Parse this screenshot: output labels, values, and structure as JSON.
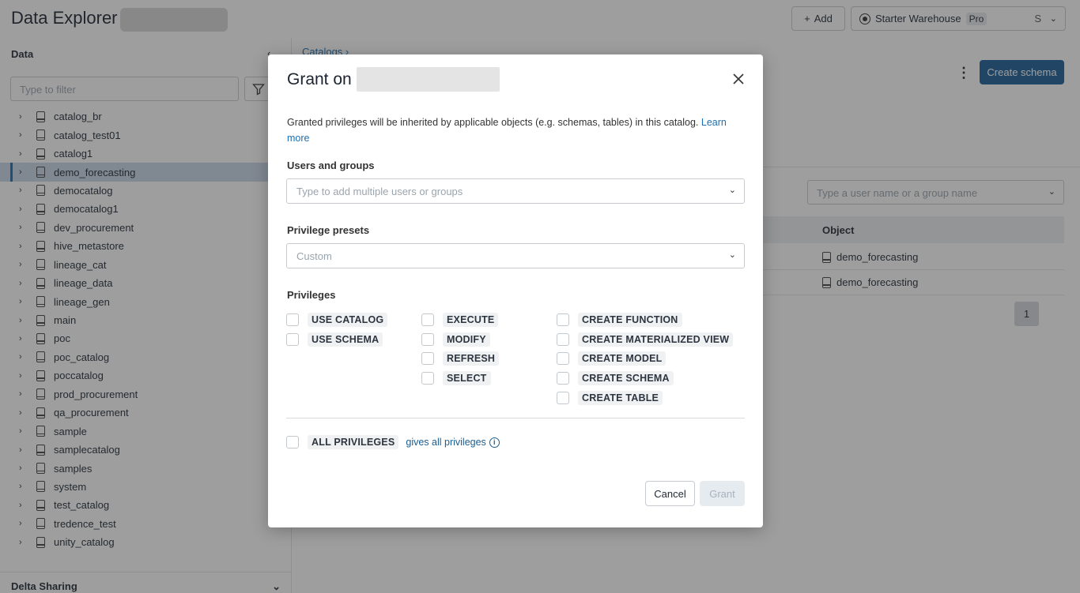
{
  "app": {
    "title": "Data Explorer",
    "add_label": "Add",
    "warehouse_name": "Starter Warehouse",
    "warehouse_tier": "Pro",
    "warehouse_size": "S"
  },
  "sidebar": {
    "heading": "Data",
    "filter_placeholder": "Type to filter",
    "catalogs": [
      "catalog_br",
      "catalog_test01",
      "catalog1",
      "demo_forecasting",
      "democatalog",
      "democatalog1",
      "dev_procurement",
      "hive_metastore",
      "lineage_cat",
      "lineage_data",
      "lineage_gen",
      "main",
      "poc",
      "poc_catalog",
      "poccatalog",
      "prod_procurement",
      "qa_procurement",
      "sample",
      "samplecatalog",
      "samples",
      "system",
      "test_catalog",
      "tredence_test",
      "unity_catalog"
    ],
    "active_catalog": "demo_forecasting",
    "delta_sharing_label": "Delta Sharing"
  },
  "main": {
    "breadcrumb": "Catalogs  ›",
    "create_schema_label": "Create schema",
    "permission_search_placeholder": "Type a user name or a group name",
    "table_header_object": "Object",
    "rows": [
      "demo_forecasting",
      "demo_forecasting"
    ],
    "page_number": "1"
  },
  "modal": {
    "title": "Grant on",
    "description": "Granted privileges will be inherited by applicable objects (e.g. schemas, tables) in this catalog.",
    "learn_more": "Learn more",
    "users_label": "Users and groups",
    "users_placeholder": "Type to add multiple users or groups",
    "presets_label": "Privilege presets",
    "presets_value": "Custom",
    "privileges_label": "Privileges",
    "privileges_col1": [
      "USE CATALOG",
      "USE SCHEMA"
    ],
    "privileges_col2": [
      "EXECUTE",
      "MODIFY",
      "REFRESH",
      "SELECT"
    ],
    "privileges_col3": [
      "CREATE FUNCTION",
      "CREATE MATERIALIZED VIEW",
      "CREATE MODEL",
      "CREATE SCHEMA",
      "CREATE TABLE"
    ],
    "all_privileges": "ALL PRIVILEGES",
    "all_privileges_note": "gives all privileges",
    "cancel_label": "Cancel",
    "grant_label": "Grant"
  },
  "colors": {
    "primary": "#1d5f98",
    "link": "#1a6fb5",
    "active_row": "#c9d8e8"
  }
}
